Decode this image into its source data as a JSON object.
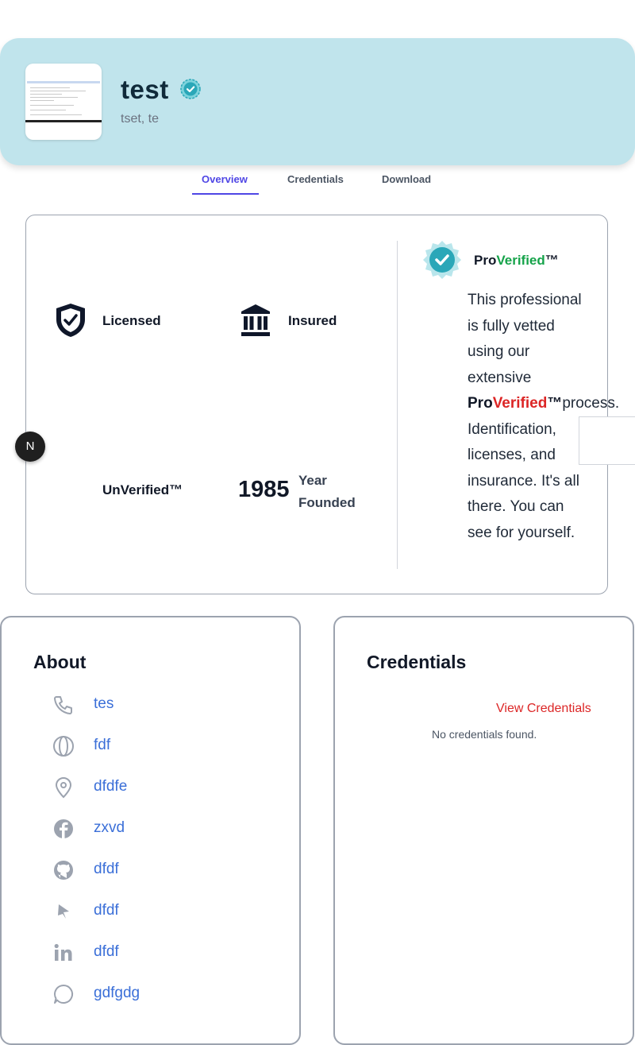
{
  "header": {
    "title": "test",
    "subtitle": "tset, te"
  },
  "tabs": [
    {
      "label": "Overview",
      "active": true
    },
    {
      "label": "Credentials",
      "active": false
    },
    {
      "label": "Download",
      "active": false
    }
  ],
  "overview": {
    "features": {
      "licensed": "Licensed",
      "insured": "Insured",
      "unverified": "UnVerified™"
    },
    "year": {
      "value": "1985",
      "label": "Year Founded"
    },
    "proverified": {
      "title_pro": "Pro",
      "title_verified": "Verified",
      "title_tm": "™",
      "text_before": "This professional is fully vetted using our extensive",
      "brand_pro": "Pro",
      "brand_verified": "Verified",
      "brand_tm": "™",
      "text_after": "process. Identification, licenses, and insurance. It's all there. You can see for yourself."
    }
  },
  "badge": {
    "letter": "N"
  },
  "about": {
    "title": "About",
    "items": [
      {
        "icon": "phone-icon",
        "value": "tes"
      },
      {
        "icon": "globe-icon",
        "value": "fdf"
      },
      {
        "icon": "map-pin-icon",
        "value": "dfdfe"
      },
      {
        "icon": "facebook-icon",
        "value": "zxvd"
      },
      {
        "icon": "github-icon",
        "value": "dfdf"
      },
      {
        "icon": "arrow-tag-icon",
        "value": "dfdf"
      },
      {
        "icon": "linkedin-icon",
        "value": "dfdf"
      },
      {
        "icon": "chat-bubble-icon",
        "value": "gdfgdg"
      }
    ]
  },
  "credentials": {
    "title": "Credentials",
    "view_link": "View Credentials",
    "empty_text": "No credentials found."
  },
  "colors": {
    "header_bg": "#c0e4ec",
    "accent_tab": "#4f46e5",
    "verified_green": "#16a34a",
    "verified_red": "#dc2626",
    "link_blue": "#3b6fd8",
    "badge_teal": "#2aa7b8"
  }
}
